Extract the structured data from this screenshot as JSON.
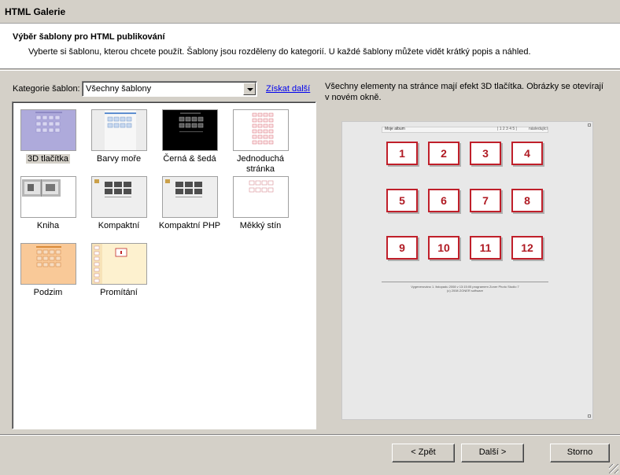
{
  "window": {
    "title": "HTML Galerie"
  },
  "header": {
    "title": "Výběr šablony pro HTML publikování",
    "subtitle": "Vyberte si šablonu, kterou chcete použít. Šablony jsou rozděleny do kategorií. U každé šablony můžete vidět krátký popis a náhled."
  },
  "category": {
    "label": "Kategorie šablon:",
    "selected": "Všechny šablony",
    "more_link": "Získat další"
  },
  "templates": [
    {
      "label": "3D tlačítka",
      "selected": true
    },
    {
      "label": "Barvy moře"
    },
    {
      "label": "Černá & šedá"
    },
    {
      "label": "Jednoduchá stránka"
    },
    {
      "label": "Kniha"
    },
    {
      "label": "Kompaktní"
    },
    {
      "label": "Kompaktní PHP"
    },
    {
      "label": "Měkký stín"
    },
    {
      "label": "Podzim"
    },
    {
      "label": "Promítání"
    }
  ],
  "description": "Všechny elementy na stránce mají efekt 3D tlačítka. Obrázky se otevírají v novém okně.",
  "preview": {
    "album_title": "Moje album",
    "pager": "| 1 2 3 4 5 |",
    "right_link": "následující",
    "buttons": [
      "1",
      "2",
      "3",
      "4",
      "5",
      "6",
      "7",
      "8",
      "9",
      "10",
      "11",
      "12"
    ],
    "footer_line1": "Vygenerováno 1. listopadu 2008 v 13:15:05 programem Zoner Photo Studio 7",
    "footer_line2": "(c) 2008 ZONER software"
  },
  "buttons": {
    "back": "< Zpět",
    "next": "Další >",
    "cancel": "Storno"
  }
}
